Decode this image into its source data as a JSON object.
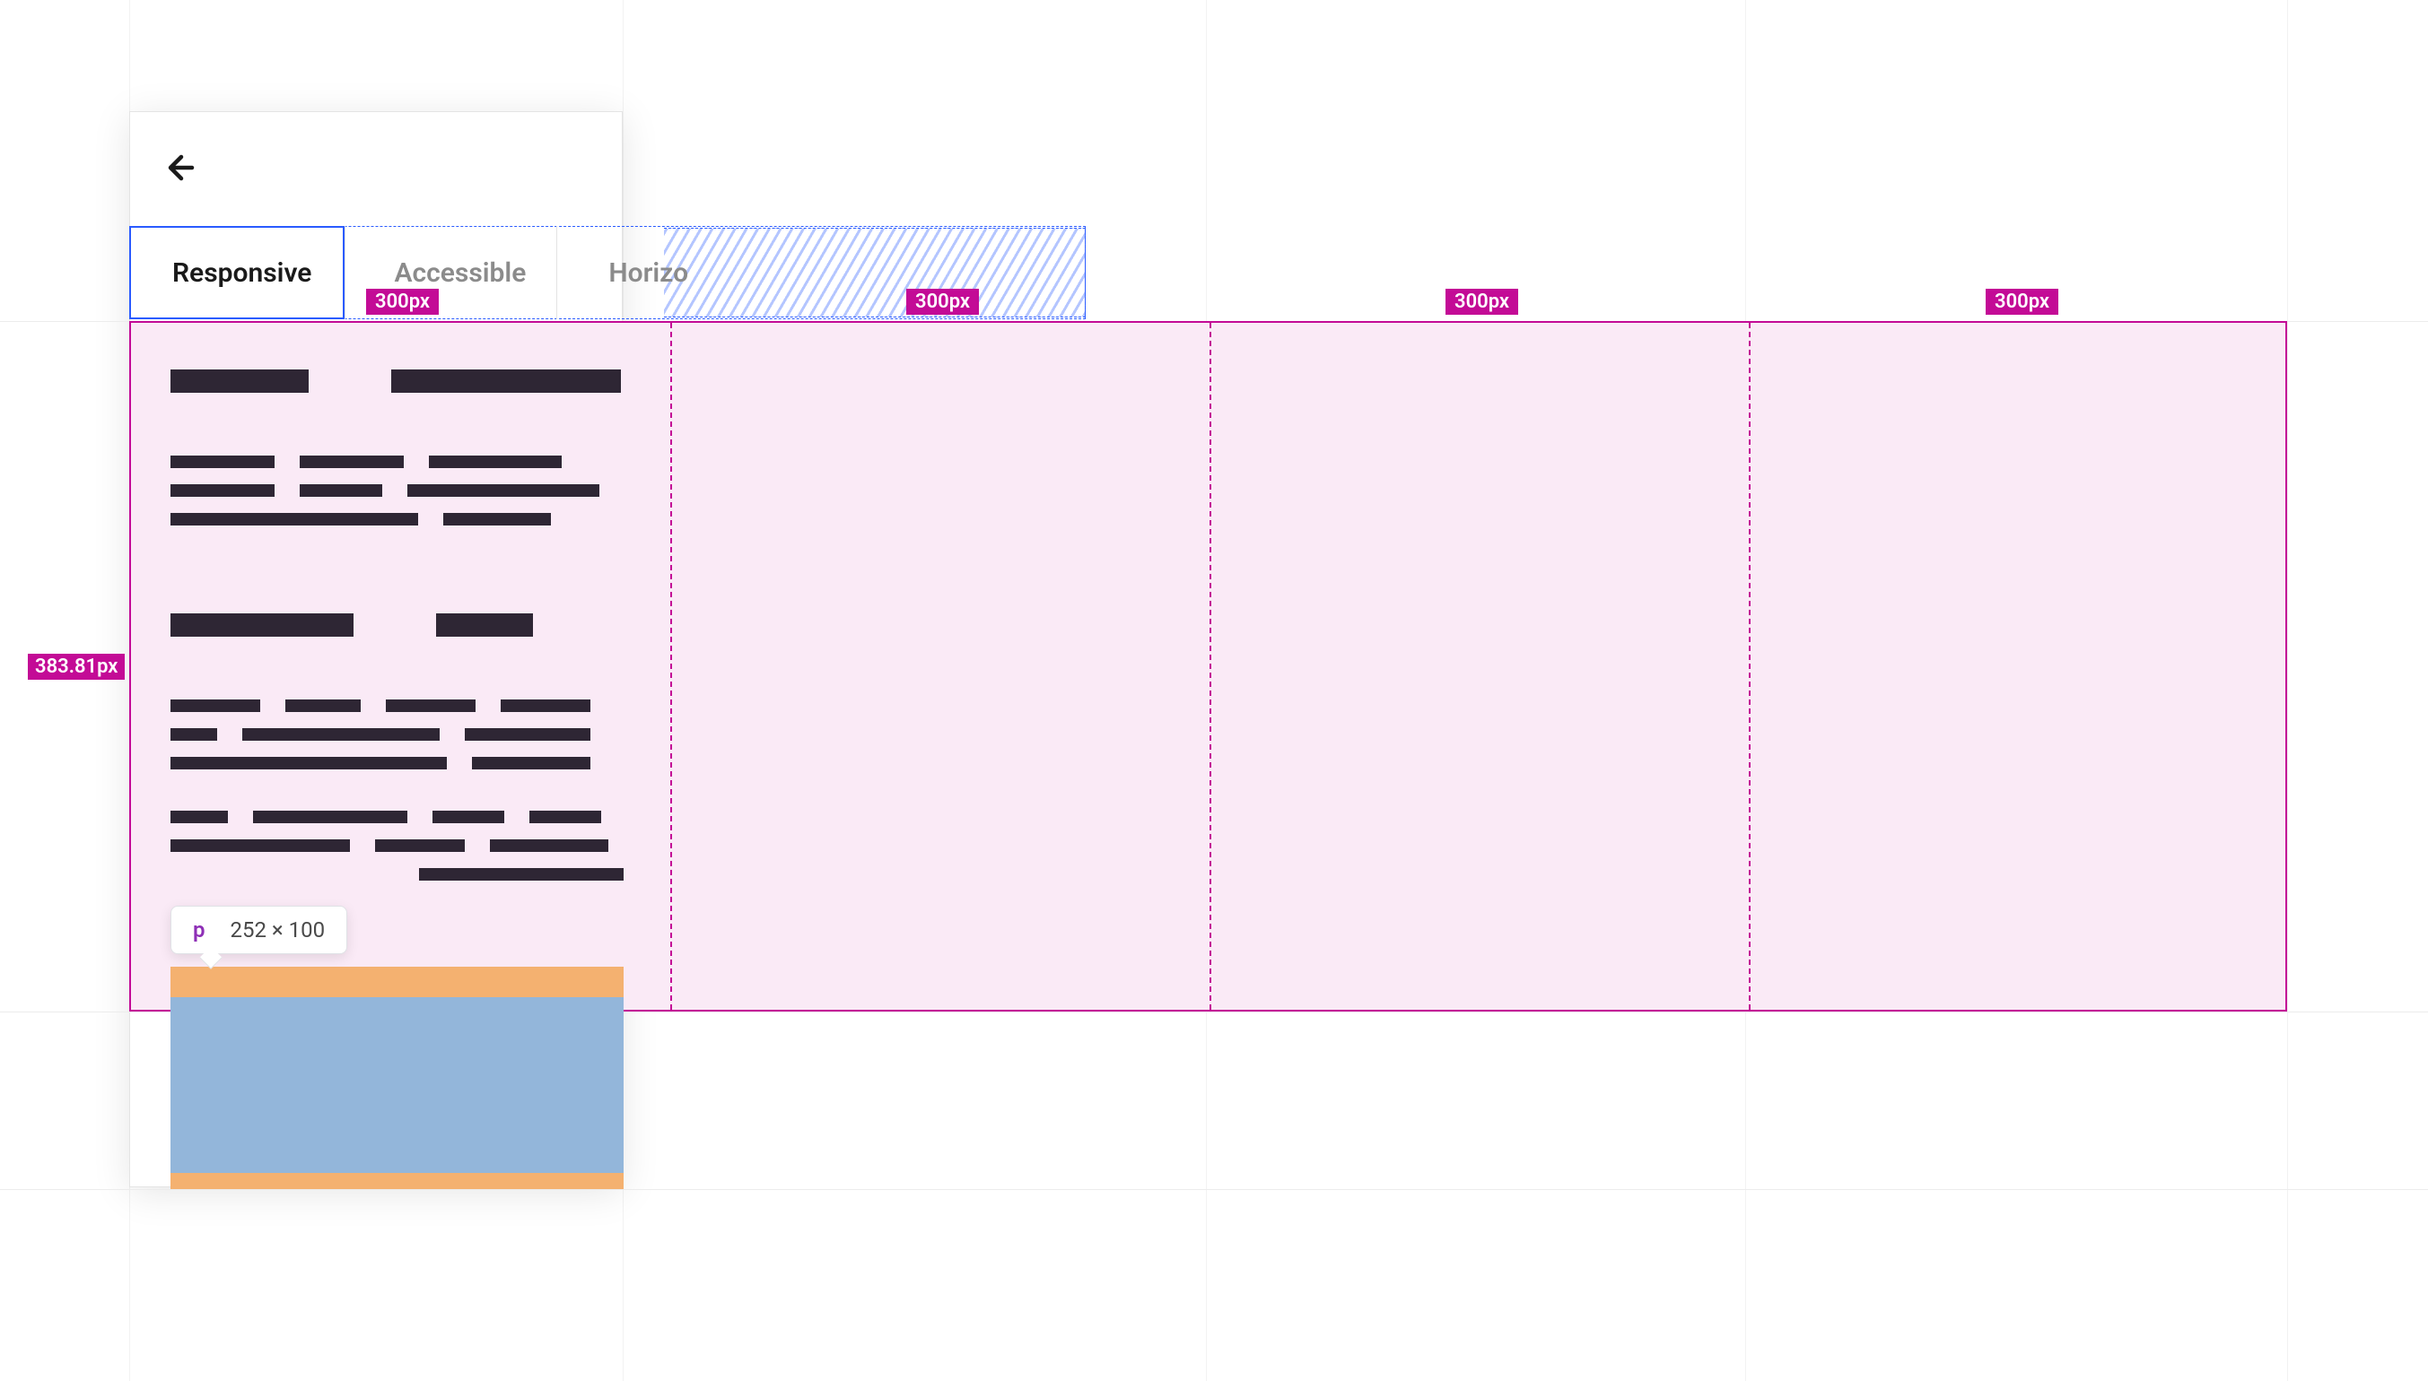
{
  "device": {
    "back_icon_name": "arrow-left-icon"
  },
  "tabs": {
    "items": [
      "Responsive",
      "Accessible",
      "Horizo"
    ],
    "active_index": 0
  },
  "grid_inspector": {
    "column_badges": [
      "300px",
      "300px",
      "300px",
      "300px"
    ],
    "height_badge": "383.81px"
  },
  "tooltip": {
    "tag": "p",
    "dimensions": "252 × 100"
  }
}
